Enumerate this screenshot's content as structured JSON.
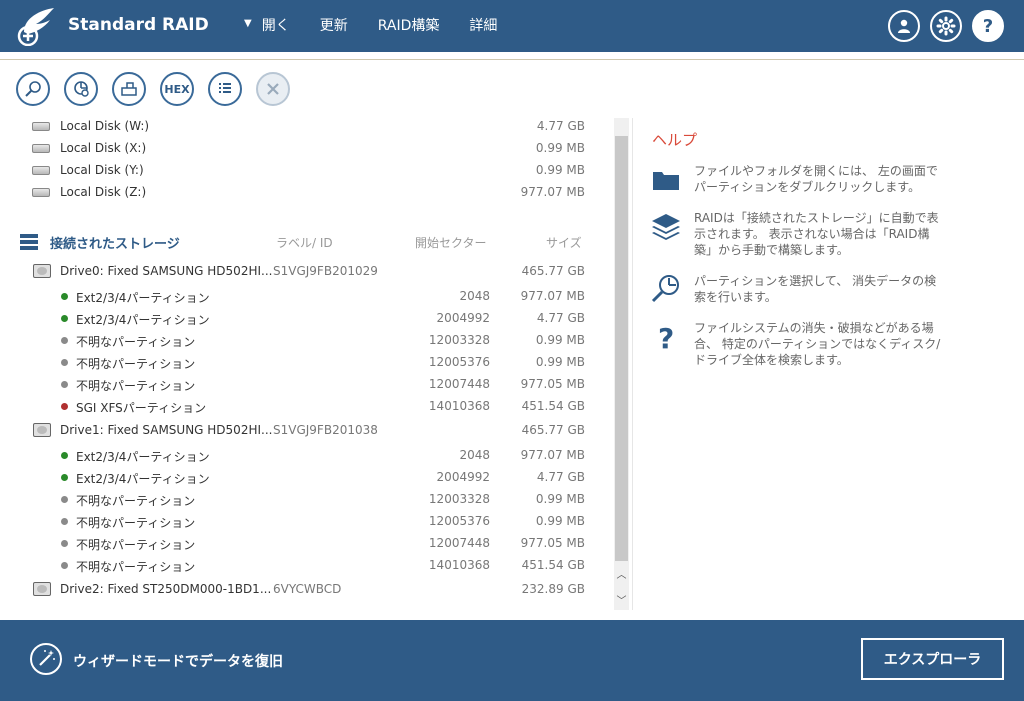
{
  "header": {
    "title": "Standard RAID",
    "menu": [
      "開く",
      "更新",
      "RAID構築",
      "詳細"
    ],
    "help_label": "?"
  },
  "toolbar": {
    "hex_label": "HEX"
  },
  "local_disks": [
    {
      "name": "Local Disk (W:)",
      "size": "4.77 GB"
    },
    {
      "name": "Local Disk (X:)",
      "size": "0.99 MB"
    },
    {
      "name": "Local Disk (Y:)",
      "size": "0.99 MB"
    },
    {
      "name": "Local Disk (Z:)",
      "size": "977.07 MB"
    }
  ],
  "storage_section": {
    "title": "接続されたストレージ",
    "col_label": "ラベル/ ID",
    "col_sector": "開始セクター",
    "col_size": "サイズ"
  },
  "drives": [
    {
      "name": "Drive0: Fixed SAMSUNG HD502HI...",
      "id": "S1VGJ9FB201029",
      "size": "465.77 GB",
      "partitions": [
        {
          "name": "Ext2/3/4パーティション",
          "sector": "2048",
          "size": "977.07 MB",
          "status": "ok"
        },
        {
          "name": "Ext2/3/4パーティション",
          "sector": "2004992",
          "size": "4.77 GB",
          "status": "ok"
        },
        {
          "name": "不明なパーティション",
          "sector": "12003328",
          "size": "0.99 MB",
          "status": "unknown"
        },
        {
          "name": "不明なパーティション",
          "sector": "12005376",
          "size": "0.99 MB",
          "status": "unknown"
        },
        {
          "name": "不明なパーティション",
          "sector": "12007448",
          "size": "977.05 MB",
          "status": "unknown"
        },
        {
          "name": "SGI XFSパーティション",
          "sector": "14010368",
          "size": "451.54 GB",
          "status": "error"
        }
      ]
    },
    {
      "name": "Drive1: Fixed SAMSUNG HD502HI...",
      "id": "S1VGJ9FB201038",
      "size": "465.77 GB",
      "partitions": [
        {
          "name": "Ext2/3/4パーティション",
          "sector": "2048",
          "size": "977.07 MB",
          "status": "ok"
        },
        {
          "name": "Ext2/3/4パーティション",
          "sector": "2004992",
          "size": "4.77 GB",
          "status": "ok"
        },
        {
          "name": "不明なパーティション",
          "sector": "12003328",
          "size": "0.99 MB",
          "status": "unknown"
        },
        {
          "name": "不明なパーティション",
          "sector": "12005376",
          "size": "0.99 MB",
          "status": "unknown"
        },
        {
          "name": "不明なパーティション",
          "sector": "12007448",
          "size": "977.05 MB",
          "status": "unknown"
        },
        {
          "name": "不明なパーティション",
          "sector": "14010368",
          "size": "451.54 GB",
          "status": "unknown"
        }
      ]
    },
    {
      "name": "Drive2: Fixed ST250DM000-1BD1...",
      "id": "6VYCWBCD",
      "size": "232.89 GB",
      "partitions": []
    }
  ],
  "help": {
    "title": "ヘルプ",
    "items": [
      {
        "icon": "folder-icon",
        "text": "ファイルやフォルダを開くには、 左の画面でパーティションをダブルクリックします。"
      },
      {
        "icon": "layers-icon",
        "text": "RAIDは「接続されたストレージ」に自動で表示されます。 表示されない場合は「RAID構築」から手動で構築します。"
      },
      {
        "icon": "search-pie-icon",
        "text": "パーティションを選択して、 消失データの検索を行います。"
      },
      {
        "icon": "question-icon",
        "text": "ファイルシステムの消失・破損などがある場合、 特定のパーティションではなくディスク/ドライブ全体を検索します。"
      }
    ]
  },
  "footer": {
    "wizard_label": "ウィザードモードでデータを復旧",
    "explorer_label": "エクスプローラ"
  },
  "colors": {
    "header_bg": "#2f5b87",
    "ok": "#2a8a2a",
    "unknown": "#8a8a8a",
    "error": "#b03030",
    "help_title": "#d94a3a"
  }
}
